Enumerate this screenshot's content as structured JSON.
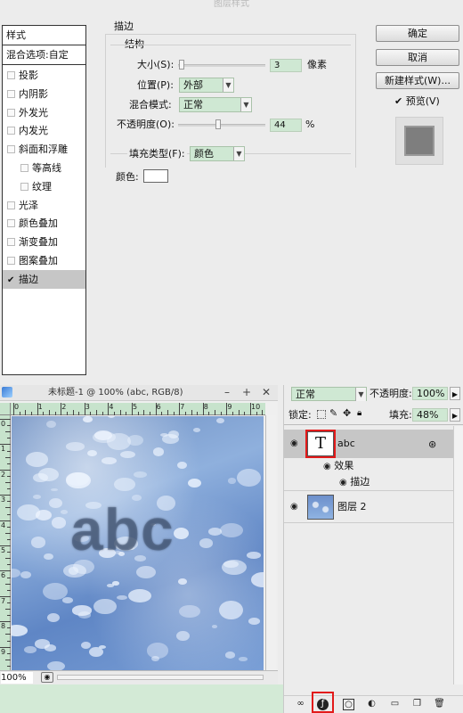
{
  "dialog": {
    "title": "图层样式",
    "styles_header": "样式",
    "blend_options": "混合选项:自定",
    "style_items": [
      {
        "label": "投影",
        "checked": false,
        "sub": false
      },
      {
        "label": "内阴影",
        "checked": false,
        "sub": false
      },
      {
        "label": "外发光",
        "checked": false,
        "sub": false
      },
      {
        "label": "内发光",
        "checked": false,
        "sub": false
      },
      {
        "label": "斜面和浮雕",
        "checked": false,
        "sub": false
      },
      {
        "label": "等高线",
        "checked": false,
        "sub": true
      },
      {
        "label": "纹理",
        "checked": false,
        "sub": true
      },
      {
        "label": "光泽",
        "checked": false,
        "sub": false
      },
      {
        "label": "颜色叠加",
        "checked": false,
        "sub": false
      },
      {
        "label": "渐变叠加",
        "checked": false,
        "sub": false
      },
      {
        "label": "图案叠加",
        "checked": false,
        "sub": false
      },
      {
        "label": "描边",
        "checked": true,
        "sub": false,
        "selected": true
      }
    ],
    "section_title": "描边",
    "structure_title": "结构",
    "size_label": "大小(S):",
    "size_value": "3",
    "size_unit": "像素",
    "position_label": "位置(P):",
    "position_value": "外部",
    "blend_mode_label": "混合模式:",
    "blend_mode_value": "正常",
    "opacity_label": "不透明度(O):",
    "opacity_value": "44",
    "opacity_unit": "%",
    "fill_type_label": "填充类型(F):",
    "fill_type_value": "颜色",
    "color_label": "颜色:",
    "stroke_color": "#ffffff",
    "ok_button": "确定",
    "cancel_button": "取消",
    "new_style_button": "新建样式(W)...",
    "preview_label": "预览(V)",
    "preview_checked": true
  },
  "document": {
    "title": "未标题-1 @ 100% (abc, RGB/8)",
    "ruler_numbers": [
      "0",
      "1",
      "2",
      "3",
      "4",
      "5",
      "6",
      "7",
      "8",
      "9",
      "10"
    ],
    "ruler_v_numbers": [
      "0",
      "1",
      "2",
      "3",
      "4",
      "5",
      "6",
      "7",
      "8",
      "9"
    ],
    "canvas_text": "abc",
    "zoom": "100%",
    "minimize_glyph": "–",
    "maximize_glyph": "+",
    "close_glyph": "✕"
  },
  "layers": {
    "blend_mode": "正常",
    "opacity_label": "不透明度:",
    "opacity_value": "100%",
    "lock_label": "锁定:",
    "fill_label": "填充:",
    "fill_value": "48%",
    "text_layer_thumb": "T",
    "text_layer_name": "abc",
    "effects_label": "效果",
    "stroke_effect_label": "描边",
    "image_layer_name": "图层 2"
  },
  "colors": {
    "field_green": "#cfe8d3",
    "selection_gray": "#c6c6c6",
    "highlight_red": "#e21a1a"
  }
}
